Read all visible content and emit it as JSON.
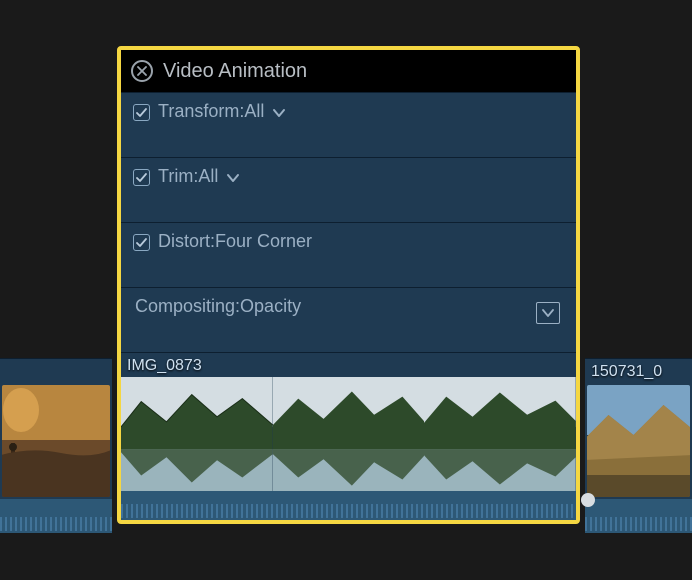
{
  "panel": {
    "title": "Video Animation",
    "effects": [
      {
        "label": "Transform:All",
        "checked": true,
        "dropdown": true,
        "expand": false
      },
      {
        "label": "Trim:All",
        "checked": true,
        "dropdown": true,
        "expand": false
      },
      {
        "label": "Distort:Four Corner",
        "checked": true,
        "dropdown": false,
        "expand": false
      },
      {
        "label": "Compositing:Opacity",
        "checked": null,
        "dropdown": false,
        "expand": true
      }
    ],
    "clip_name": "IMG_0873"
  },
  "timeline": {
    "left_clip_name": "",
    "right_clip_name": "150731_0"
  },
  "colors": {
    "highlight_border": "#f5d742",
    "panel_bg": "#1f3a52",
    "text": "#9bb0c4"
  }
}
